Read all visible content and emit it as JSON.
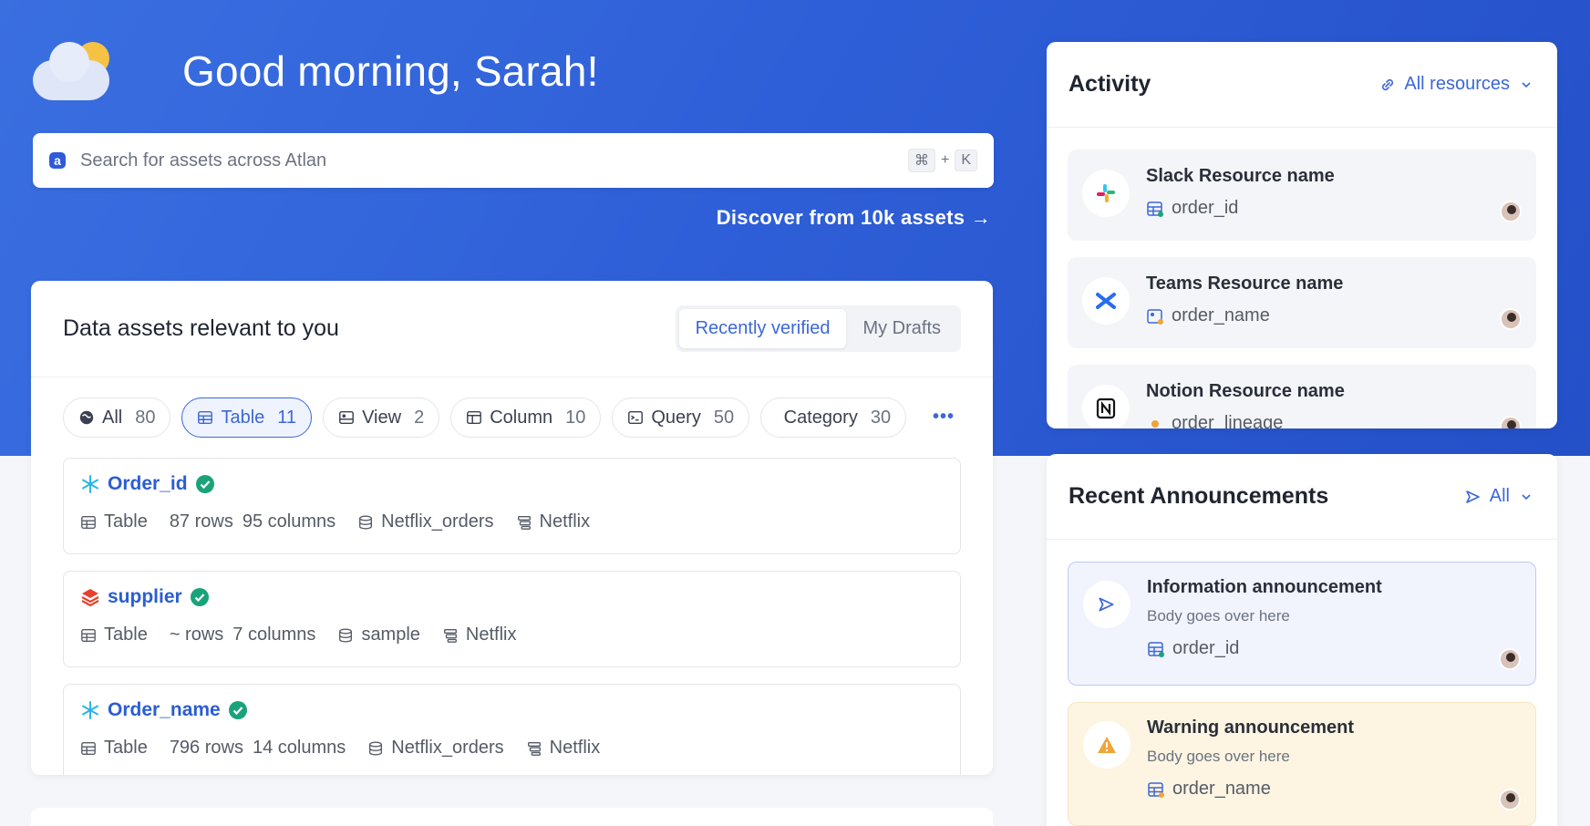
{
  "greeting": {
    "text": "Good morning, Sarah!"
  },
  "search": {
    "placeholder": "Search for assets across Atlan",
    "shortcut_cmd": "⌘",
    "shortcut_plus": "+",
    "shortcut_key": "K"
  },
  "discover": {
    "label": "Discover from 10k assets →"
  },
  "assets": {
    "title": "Data assets relevant to you",
    "tabs": [
      {
        "label": "Recently verified",
        "active": true
      },
      {
        "label": "My Drafts",
        "active": false
      }
    ],
    "filters": [
      {
        "label": "All",
        "count": "80",
        "icon": "globe-icon"
      },
      {
        "label": "Table",
        "count": "11",
        "icon": "table-icon",
        "active": true
      },
      {
        "label": "View",
        "count": "2",
        "icon": "view-icon"
      },
      {
        "label": "Column",
        "count": "10",
        "icon": "column-icon"
      },
      {
        "label": "Query",
        "count": "50",
        "icon": "query-icon"
      },
      {
        "label": "Category",
        "count": "30",
        "icon": "category-icon"
      }
    ],
    "more_label": "•••",
    "items": [
      {
        "name": "Order_id",
        "source": "snowflake",
        "type": "Table",
        "rows": "87 rows",
        "columns": "95 columns",
        "schema": "Netflix_orders",
        "database": "Netflix"
      },
      {
        "name": "supplier",
        "source": "databricks",
        "type": "Table",
        "rows": "~ rows",
        "columns": "7 columns",
        "schema": "sample",
        "database": "Netflix"
      },
      {
        "name": "Order_name",
        "source": "snowflake",
        "type": "Table",
        "rows": "796 rows",
        "columns": "14 columns",
        "schema": "Netflix_orders",
        "database": "Netflix"
      }
    ]
  },
  "activity": {
    "title": "Activity",
    "filter_label": "All resources",
    "items": [
      {
        "title": "Slack Resource name",
        "ref": "order_id",
        "icon": "slack-icon"
      },
      {
        "title": "Teams Resource name",
        "ref": "order_name",
        "icon": "teams-icon"
      },
      {
        "title": "Notion Resource name",
        "ref": "order_lineage",
        "icon": "notion-icon"
      }
    ]
  },
  "announcements": {
    "title": "Recent Announcements",
    "filter_label": "All",
    "items": [
      {
        "title": "Information announcement",
        "body": "Body goes over here",
        "ref": "order_id",
        "kind": "info"
      },
      {
        "title": "Warning announcement",
        "body": "Body goes over here",
        "ref": "order_name",
        "kind": "warning"
      }
    ]
  },
  "colors": {
    "brand": "#2f5fd8",
    "accent": "#3c67d8",
    "verified": "#1aa37a",
    "warning": "#f0a53a"
  }
}
